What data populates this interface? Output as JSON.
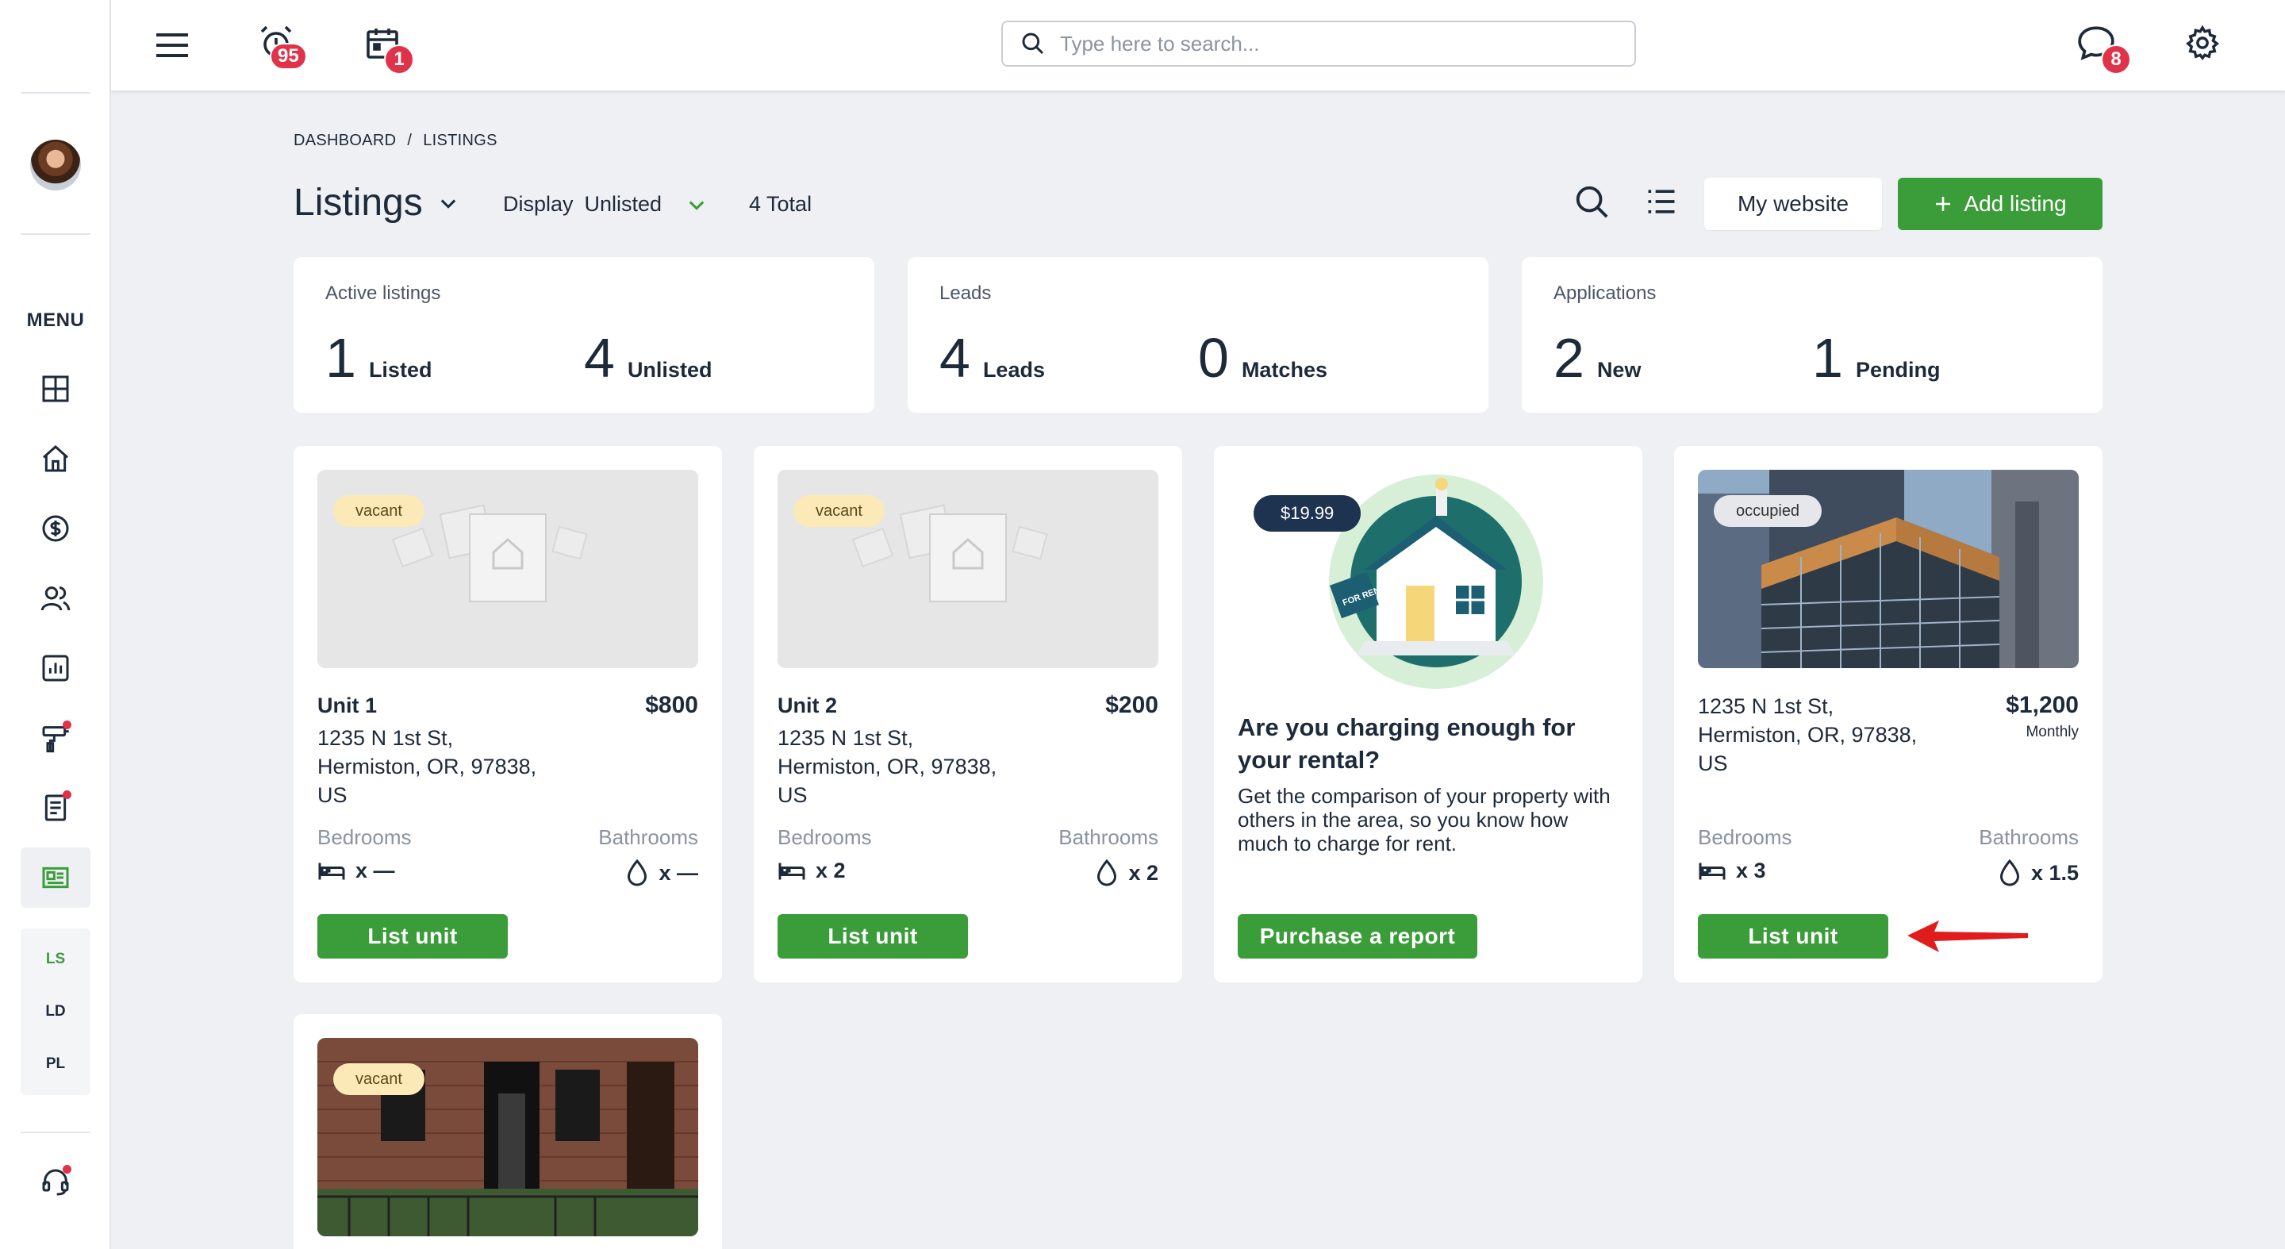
{
  "sidebar": {
    "menu_label": "MENU",
    "sub_items": [
      "LS",
      "LD",
      "PL"
    ]
  },
  "topbar": {
    "alarm_badge": "95",
    "calendar_badge": "1",
    "search_placeholder": "Type here to search...",
    "chat_badge": "8"
  },
  "breadcrumb": {
    "items": [
      "DASHBOARD",
      "/",
      "LISTINGS"
    ]
  },
  "header": {
    "title": "Listings",
    "display_label": "Display",
    "display_value": "Unlisted",
    "total": "4 Total",
    "website_button": "My website",
    "add_button": "Add listing"
  },
  "stats": [
    {
      "title": "Active listings",
      "a_num": "1",
      "a_label": "Listed",
      "b_num": "4",
      "b_label": "Unlisted"
    },
    {
      "title": "Leads",
      "a_num": "4",
      "a_label": "Leads",
      "b_num": "0",
      "b_label": "Matches"
    },
    {
      "title": "Applications",
      "a_num": "2",
      "a_label": "New",
      "b_num": "1",
      "b_label": "Pending"
    }
  ],
  "labels": {
    "bedrooms": "Bedrooms",
    "bathrooms": "Bathrooms",
    "list_unit": "List unit"
  },
  "listings": [
    {
      "status": "vacant",
      "name": "Unit 1",
      "address": [
        "1235 N 1st St,",
        "Hermiston, OR, 97838,",
        "US"
      ],
      "price": "$800",
      "beds": "x —",
      "baths": "x —"
    },
    {
      "status": "vacant",
      "name": "Unit 2",
      "address": [
        "1235 N 1st St,",
        "Hermiston, OR, 97838,",
        "US"
      ],
      "price": "$200",
      "beds": "x 2",
      "baths": "x 2"
    },
    {
      "status": "occupied",
      "name": "",
      "address": [
        "1235 N 1st St,",
        "Hermiston, OR, 97838,",
        "US"
      ],
      "price": "$1,200",
      "frequency": "Monthly",
      "beds": "x 3",
      "baths": "x 1.5"
    },
    {
      "status": "vacant"
    }
  ],
  "promo": {
    "price": "$19.99",
    "title": "Are you charging enough for your rental?",
    "text": "Get the comparison of your property with others in the area, so you know how much to charge for rent.",
    "button": "Purchase a report",
    "sign_text": "FOR RENT"
  },
  "colors": {
    "accent_green": "#3b9c3a",
    "badge_red": "#e0334a",
    "navy": "#1e3350",
    "annotation_arrow": "#e01c1c"
  },
  "icons": [
    "hamburger-icon",
    "alarm-clock-icon",
    "calendar-icon",
    "search-icon",
    "chat-icon",
    "gear-icon",
    "dashboard-icon",
    "home-icon",
    "dollar-icon",
    "users-icon",
    "report-icon",
    "maintenance-icon",
    "document-icon",
    "listings-icon",
    "support-icon",
    "list-view-icon",
    "bed-icon",
    "water-drop-icon",
    "plus-icon",
    "chevron-down-icon"
  ]
}
